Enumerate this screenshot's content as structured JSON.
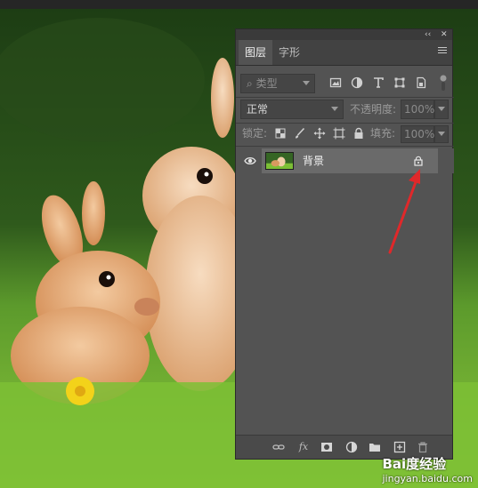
{
  "panel": {
    "header_buttons": [
      "‹‹",
      "✕"
    ],
    "tabs": [
      {
        "label": "图层",
        "active": true
      },
      {
        "label": "字形",
        "active": false
      }
    ],
    "filter": {
      "kind_label": "类型"
    },
    "blend": {
      "mode": "正常",
      "opacity_label": "不透明度:",
      "opacity_value": "100%"
    },
    "lock": {
      "label": "锁定:",
      "fill_label": "填充:",
      "fill_value": "100%"
    },
    "layers": [
      {
        "name": "背景",
        "visible": true,
        "locked": true
      }
    ]
  },
  "watermark": {
    "brand": "Bai度经验",
    "url": "jingyan.baidu.com"
  },
  "colors": {
    "panel_bg": "#535353",
    "selected_layer_bg": "#6a6a6a",
    "arrow": "#e0282a"
  }
}
